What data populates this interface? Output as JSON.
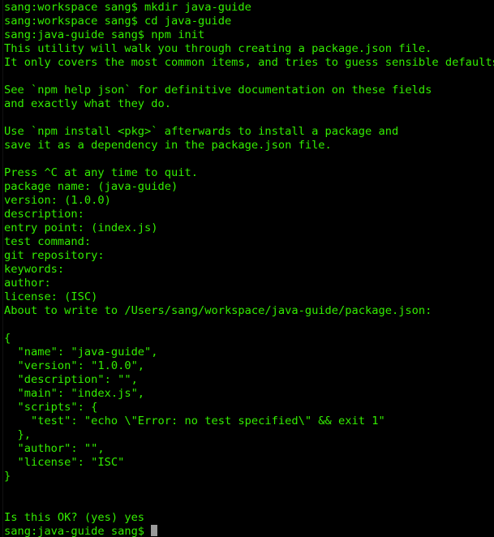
{
  "terminal": {
    "app_name": "Terminal",
    "theme": {
      "background": "#000000",
      "foreground": "#33ee00",
      "cursor": "#9a9a9a"
    },
    "shell_prompt_user": "sang",
    "cursor_glyph": "block-cursor",
    "lines": [
      {
        "id": "l01",
        "text": "sang:workspace sang$ mkdir java-guide",
        "kind": "shell-command",
        "clipped_bracket": true
      },
      {
        "id": "l02",
        "text": "sang:workspace sang$ cd java-guide",
        "kind": "shell-command",
        "clipped_bracket": true
      },
      {
        "id": "l03",
        "text": "sang:java-guide sang$ npm init",
        "kind": "shell-command",
        "clipped_bracket": true
      },
      {
        "id": "l04",
        "text": "This utility will walk you through creating a package.json file.",
        "kind": "output",
        "clipped_bracket": false
      },
      {
        "id": "l05",
        "text": "It only covers the most common items, and tries to guess sensible defaults.",
        "kind": "output",
        "clipped_bracket": false
      },
      {
        "id": "l06",
        "text": "",
        "kind": "blank",
        "clipped_bracket": false
      },
      {
        "id": "l07",
        "text": "See `npm help json` for definitive documentation on these fields",
        "kind": "output",
        "clipped_bracket": false
      },
      {
        "id": "l08",
        "text": "and exactly what they do.",
        "kind": "output",
        "clipped_bracket": false
      },
      {
        "id": "l09",
        "text": "",
        "kind": "blank",
        "clipped_bracket": false
      },
      {
        "id": "l10",
        "text": "Use `npm install <pkg>` afterwards to install a package and",
        "kind": "output",
        "clipped_bracket": false
      },
      {
        "id": "l11",
        "text": "save it as a dependency in the package.json file.",
        "kind": "output",
        "clipped_bracket": false
      },
      {
        "id": "l12",
        "text": "",
        "kind": "blank",
        "clipped_bracket": false
      },
      {
        "id": "l13",
        "text": "Press ^C at any time to quit.",
        "kind": "output",
        "clipped_bracket": false
      },
      {
        "id": "l14",
        "text": "package name: (java-guide)",
        "kind": "npm-prompt",
        "clipped_bracket": true
      },
      {
        "id": "l15",
        "text": "version: (1.0.0)",
        "kind": "npm-prompt",
        "clipped_bracket": true
      },
      {
        "id": "l16",
        "text": "description:",
        "kind": "npm-prompt",
        "clipped_bracket": true
      },
      {
        "id": "l17",
        "text": "entry point: (index.js)",
        "kind": "npm-prompt",
        "clipped_bracket": true
      },
      {
        "id": "l18",
        "text": "test command:",
        "kind": "npm-prompt",
        "clipped_bracket": true
      },
      {
        "id": "l19",
        "text": "git repository:",
        "kind": "npm-prompt",
        "clipped_bracket": true
      },
      {
        "id": "l20",
        "text": "keywords:",
        "kind": "npm-prompt",
        "clipped_bracket": true
      },
      {
        "id": "l21",
        "text": "author:",
        "kind": "npm-prompt",
        "clipped_bracket": true
      },
      {
        "id": "l22",
        "text": "license: (ISC)",
        "kind": "npm-prompt",
        "clipped_bracket": true
      },
      {
        "id": "l23",
        "text": "About to write to /Users/sang/workspace/java-guide/package.json:",
        "kind": "output",
        "clipped_bracket": false
      },
      {
        "id": "l24",
        "text": "",
        "kind": "blank",
        "clipped_bracket": false
      },
      {
        "id": "l25",
        "text": "{",
        "kind": "json",
        "clipped_bracket": false
      },
      {
        "id": "l26",
        "text": "  \"name\": \"java-guide\",",
        "kind": "json",
        "clipped_bracket": false
      },
      {
        "id": "l27",
        "text": "  \"version\": \"1.0.0\",",
        "kind": "json",
        "clipped_bracket": false
      },
      {
        "id": "l28",
        "text": "  \"description\": \"\",",
        "kind": "json",
        "clipped_bracket": false
      },
      {
        "id": "l29",
        "text": "  \"main\": \"index.js\",",
        "kind": "json",
        "clipped_bracket": false
      },
      {
        "id": "l30",
        "text": "  \"scripts\": {",
        "kind": "json",
        "clipped_bracket": false
      },
      {
        "id": "l31",
        "text": "    \"test\": \"echo \\\"Error: no test specified\\\" && exit 1\"",
        "kind": "json",
        "clipped_bracket": false
      },
      {
        "id": "l32",
        "text": "  },",
        "kind": "json",
        "clipped_bracket": false
      },
      {
        "id": "l33",
        "text": "  \"author\": \"\",",
        "kind": "json",
        "clipped_bracket": false
      },
      {
        "id": "l34",
        "text": "  \"license\": \"ISC\"",
        "kind": "json",
        "clipped_bracket": false
      },
      {
        "id": "l35",
        "text": "}",
        "kind": "json",
        "clipped_bracket": false
      },
      {
        "id": "l36",
        "text": "",
        "kind": "blank",
        "clipped_bracket": false
      },
      {
        "id": "l37",
        "text": "",
        "kind": "blank",
        "clipped_bracket": false
      },
      {
        "id": "l38",
        "text": "Is this OK? (yes) yes",
        "kind": "npm-prompt",
        "clipped_bracket": true
      },
      {
        "id": "l39",
        "text": "sang:java-guide sang$ ",
        "kind": "shell-prompt-active",
        "clipped_bracket": false
      }
    ]
  }
}
